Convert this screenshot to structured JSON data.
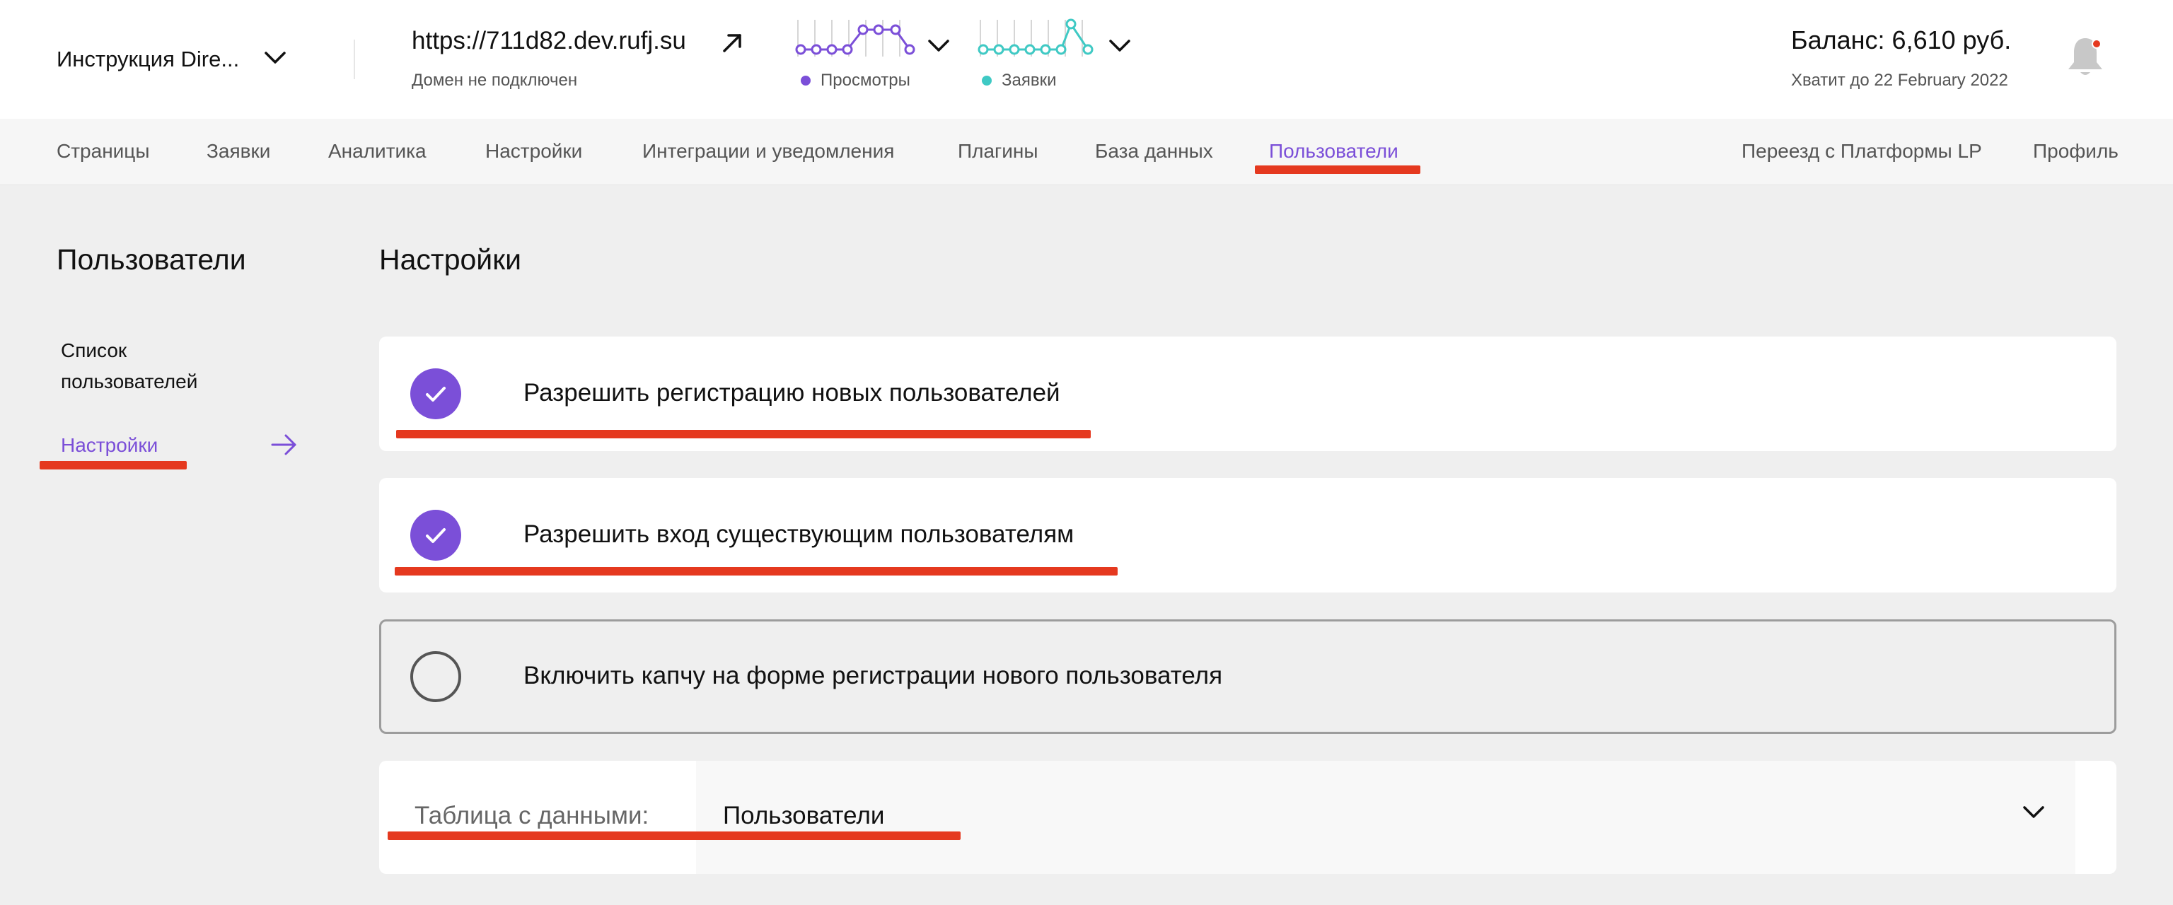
{
  "header": {
    "project_name": "Инструкция Dire...",
    "site_url": "https://711d82.dev.rufj.su",
    "domain_status": "Домен не подключен",
    "views_label": "Просмотры",
    "leads_label": "Заявки",
    "balance": "Баланс: 6,610 руб.",
    "runway": "Хватит до 22 February 2022",
    "colors": {
      "views": "#7b4fd8",
      "leads": "#3fc9c4",
      "notification": "#e5391f"
    }
  },
  "nav": {
    "items": [
      {
        "label": "Страницы"
      },
      {
        "label": "Заявки"
      },
      {
        "label": "Аналитика"
      },
      {
        "label": "Настройки"
      },
      {
        "label": "Интеграции и уведомления"
      },
      {
        "label": "Плагины"
      },
      {
        "label": "База данных"
      },
      {
        "label": "Пользователи",
        "active": true
      }
    ],
    "right_items": [
      {
        "label": "Переезд с Платформы LP"
      },
      {
        "label": "Профиль"
      }
    ],
    "accent": "#7b4fd8"
  },
  "sidebar": {
    "title": "Пользователи",
    "items": [
      {
        "label_line1": "Список",
        "label_line2": "пользователей"
      },
      {
        "label": "Настройки",
        "active": true
      }
    ]
  },
  "main": {
    "title": "Настройки",
    "settings": [
      {
        "label": "Разрешить регистрацию новых пользователей",
        "checked": true
      },
      {
        "label": "Разрешить вход существующим пользователям",
        "checked": true
      },
      {
        "label": "Включить капчу на форме регистрации нового пользователя",
        "checked": false
      }
    ],
    "table_select": {
      "label": "Таблица с данными:",
      "value": "Пользователи"
    }
  },
  "annotation_color": "#e5391f"
}
